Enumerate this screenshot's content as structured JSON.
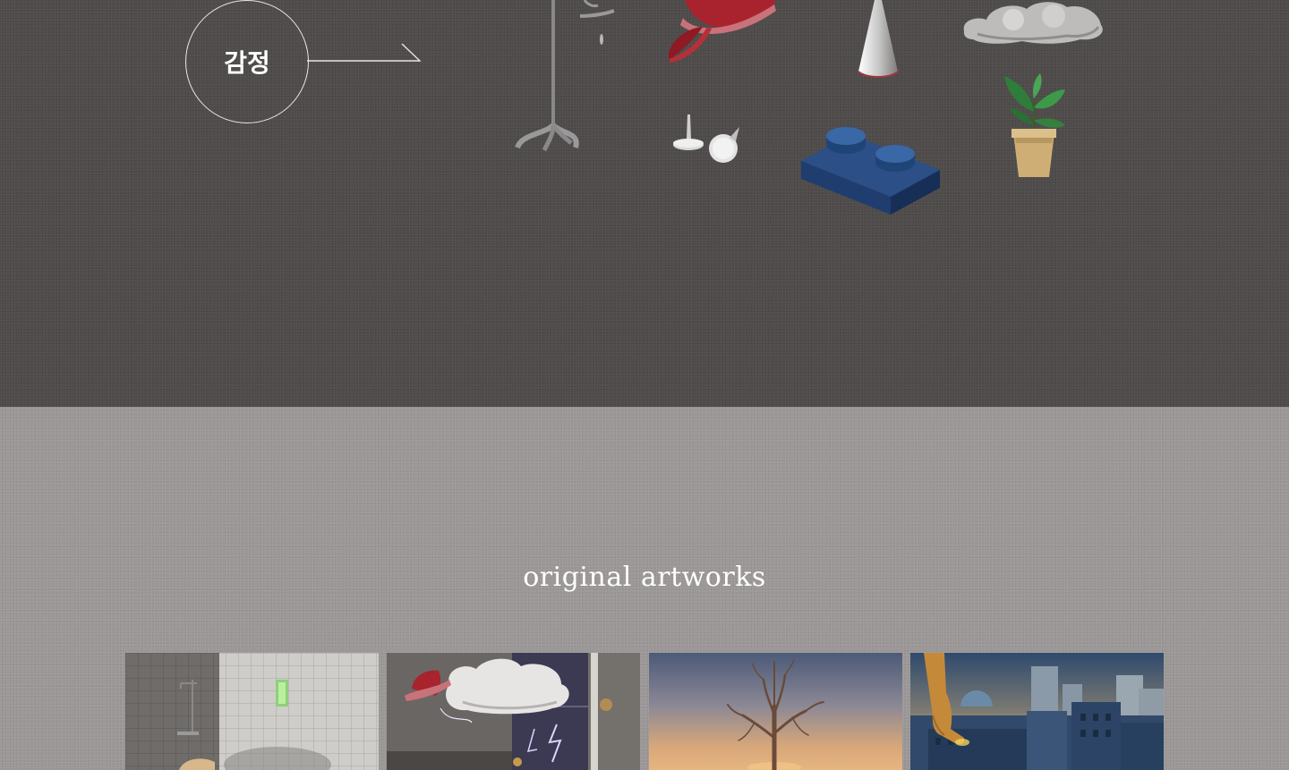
{
  "emotion_nav": {
    "label": "감정"
  },
  "objects": [
    {
      "name": "iv-stand",
      "icon": "iv-stand-icon"
    },
    {
      "name": "red-hat",
      "icon": "fedora-hat-icon"
    },
    {
      "name": "cone",
      "icon": "cone-icon"
    },
    {
      "name": "cloud",
      "icon": "cloud-icon"
    },
    {
      "name": "thumbtacks",
      "icon": "thumbtack-icon"
    },
    {
      "name": "lego-brick",
      "icon": "brick-icon"
    },
    {
      "name": "potted-plant",
      "icon": "plant-icon"
    }
  ],
  "artworks_section": {
    "title": "original artworks",
    "items": [
      {
        "name": "artwork-shower-room",
        "icon": "shower-scene-thumbnail"
      },
      {
        "name": "artwork-hat-cloud",
        "icon": "storm-cloud-scene-thumbnail"
      },
      {
        "name": "artwork-bare-tree",
        "icon": "tree-sunset-scene-thumbnail"
      },
      {
        "name": "artwork-hand-city",
        "icon": "city-hand-scene-thumbnail"
      }
    ]
  },
  "colors": {
    "top_bg": "#4e4b4a",
    "bottom_bg": "#9b9797",
    "text_light": "#ffffff",
    "hat_red": "#a8232d",
    "lego_blue": "#1f3d6e",
    "plant_green": "#2e7d3a"
  }
}
